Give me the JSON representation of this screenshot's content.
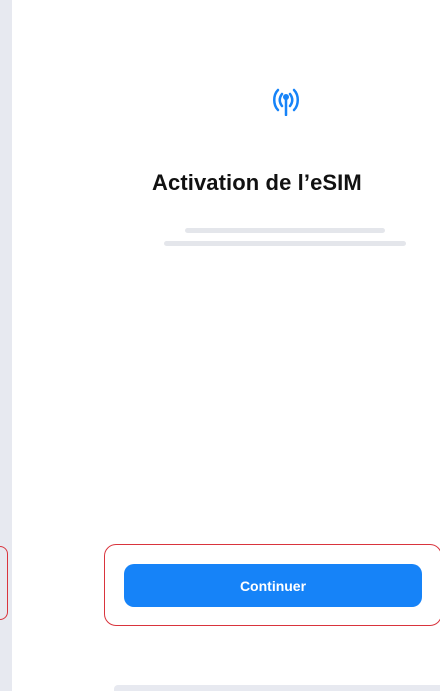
{
  "screen": {
    "title": "Activation de l’eSIM",
    "icon": "antenna-signal-icon",
    "continue_label": "Continuer"
  },
  "annotations": {
    "pointer": "arrow-right-icon",
    "highlight_color": "#d9343d"
  },
  "colors": {
    "accent": "#1683f8",
    "text": "#111111",
    "placeholder": "#e4e6eb",
    "frame": "#e7e9f0"
  }
}
